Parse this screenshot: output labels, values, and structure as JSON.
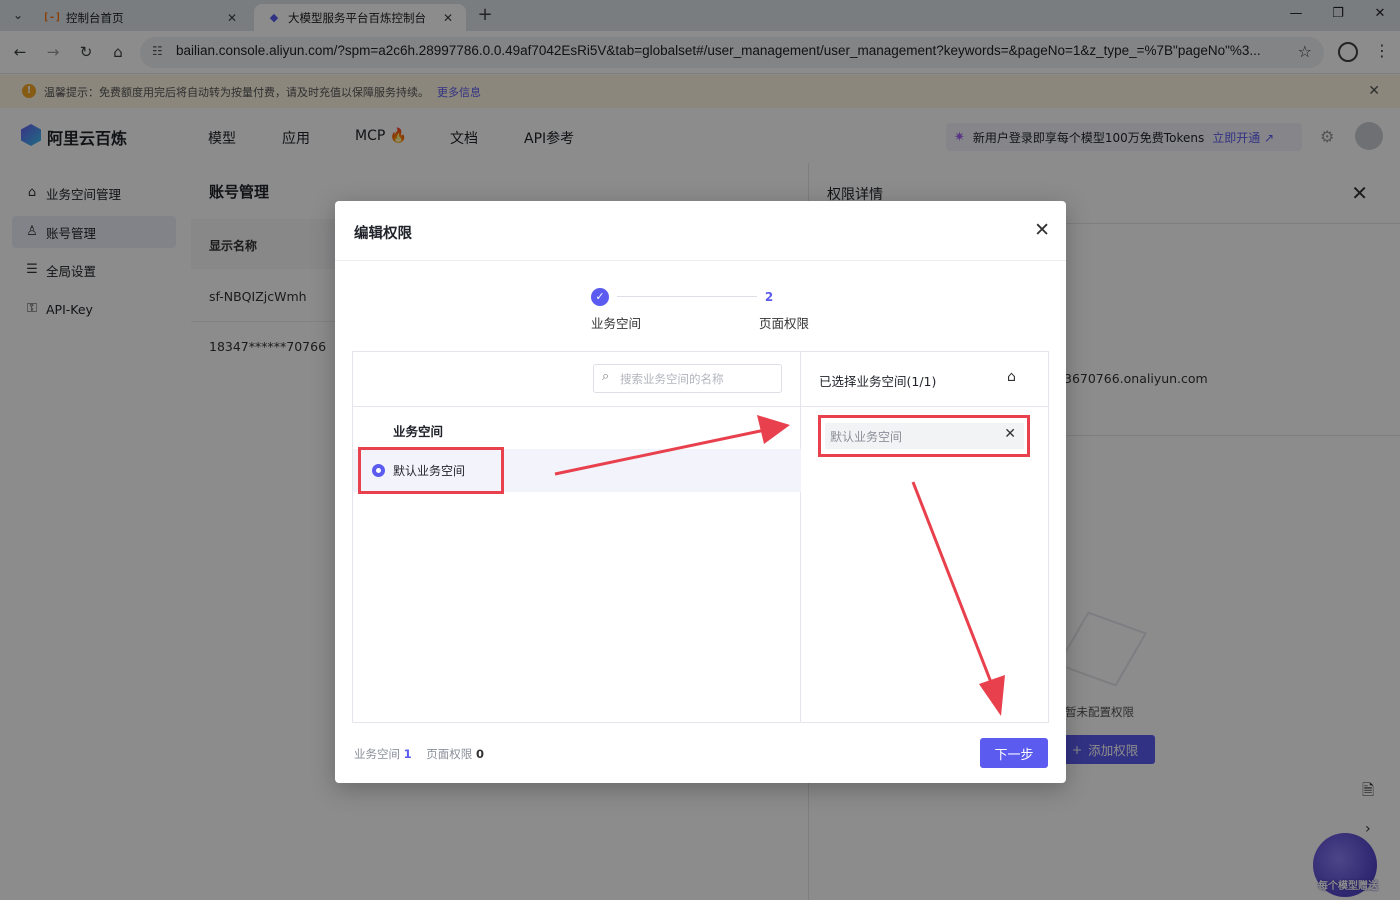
{
  "browser": {
    "tabs": [
      {
        "title": "控制台首页",
        "active": false
      },
      {
        "title": "大模型服务平台百炼控制台",
        "active": true
      }
    ],
    "url": "bailian.console.aliyun.com/?spm=a2c6h.28997786.0.0.49af7042EsRi5V&tab=globalset#/user_management/user_management?keywords=&pageNo=1&z_type_=%7B\"pageNo\"%3..."
  },
  "notice": {
    "text": "温馨提示：免费额度用完后将自动转为按量付费，请及时充值以保障服务持续。",
    "link": "更多信息"
  },
  "topnav": {
    "logo": "阿里云百炼",
    "items": [
      "模型",
      "应用",
      "MCP",
      "文档",
      "API参考"
    ],
    "promo": "新用户登录即享每个模型100万免费Tokens",
    "promo_link": "立即开通 ↗"
  },
  "sidebar": {
    "items": [
      {
        "label": "业务空间管理",
        "active": false
      },
      {
        "label": "账号管理",
        "active": true
      },
      {
        "label": "全局设置",
        "active": false
      },
      {
        "label": "API-Key",
        "active": false
      }
    ]
  },
  "content": {
    "title": "账号管理",
    "column": "显示名称",
    "rows": [
      "sf-NBQIZjcWmh",
      "18347******70766"
    ]
  },
  "right_panel": {
    "title": "权限详情",
    "email": "3670766.onaliyun.com",
    "empty_text": "暂未配置权限",
    "add_button": "添加权限"
  },
  "widget": {
    "text": "每个模型赠送"
  },
  "modal": {
    "title": "编辑权限",
    "steps": [
      {
        "index": "✓",
        "label": "业务空间"
      },
      {
        "index": "2",
        "label": "页面权限"
      }
    ],
    "search_placeholder": "搜索业务空间的名称",
    "left_column": "业务空间",
    "left_items": [
      "默认业务空间"
    ],
    "right_title": "已选择业务空间(1/1)",
    "selected_items": [
      "默认业务空间"
    ],
    "footer": {
      "space_label": "业务空间",
      "space_count": "1",
      "page_label": "页面权限",
      "page_count": "0"
    },
    "next_button": "下一步"
  },
  "colors": {
    "primary": "#5b5bf0",
    "annotation": "#e8404c"
  }
}
